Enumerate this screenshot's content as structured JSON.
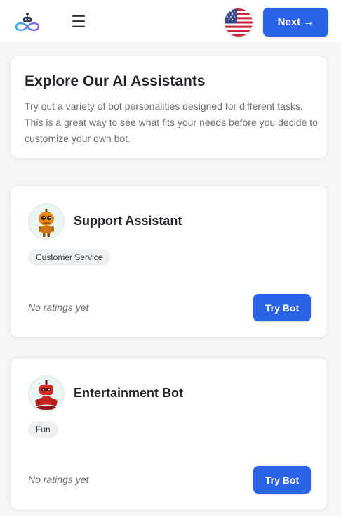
{
  "header": {
    "logo_icon": "infinity-bot-logo",
    "menu_icon": "hamburger-menu-icon",
    "menu_glyph": "☰",
    "language_icon": "us-flag-icon",
    "next_label": "Next →"
  },
  "intro": {
    "title": "Explore Our AI Assistants",
    "description": "Try out a variety of bot personalities designed for different tasks. This is a great way to see what fits your needs before you decide to customize your own bot."
  },
  "bots": [
    {
      "name": "Support Assistant",
      "avatar_icon": "orange-robot-avatar",
      "tag": "Customer Service",
      "rating": "No ratings yet",
      "button_label": "Try Bot"
    },
    {
      "name": "Entertainment Bot",
      "avatar_icon": "red-robot-avatar",
      "tag": "Fun",
      "rating": "No ratings yet",
      "button_label": "Try Bot"
    }
  ],
  "colors": {
    "primary": "#2a63e8",
    "background": "#f5f6f7"
  }
}
